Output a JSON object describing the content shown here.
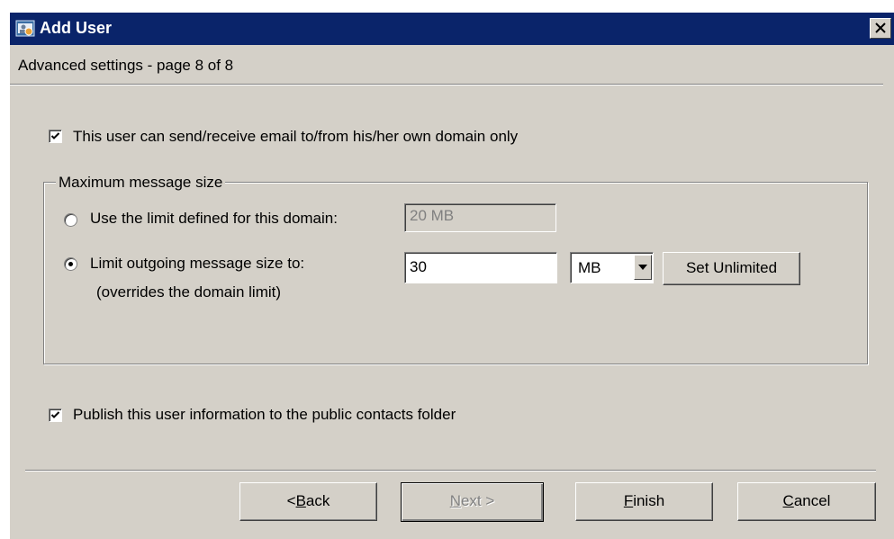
{
  "window": {
    "title": "Add User",
    "page_label": "Advanced settings - page 8 of 8"
  },
  "options": {
    "own_domain_only": {
      "label": "This user can send/receive email to/from his/her own domain only",
      "checked": true
    },
    "publish_contacts": {
      "label": "Publish this user information to the public contacts folder",
      "checked": true
    }
  },
  "size_group": {
    "legend": "Maximum message size",
    "use_domain_limit": {
      "label": "Use the limit defined for this domain:",
      "value": "20 MB",
      "selected": false
    },
    "limit_outgoing": {
      "label": "Limit outgoing message size to:",
      "note": "(overrides the domain limit)",
      "value": "30",
      "unit": "MB",
      "selected": true
    },
    "set_unlimited_label": "Set Unlimited"
  },
  "buttons": {
    "back": {
      "prefix": "< ",
      "accel": "B",
      "rest": "ack"
    },
    "next": {
      "accel": "N",
      "rest": "ext >"
    },
    "finish": {
      "accel": "F",
      "rest": "inish"
    },
    "cancel": {
      "accel": "C",
      "rest": "ancel"
    }
  },
  "icons": {
    "app": "user-window-icon",
    "close": "close-icon",
    "dropdown": "chevron-down-icon",
    "check": "checkmark-icon"
  },
  "colors": {
    "titlebar": "#0a246a",
    "face": "#d4d0c8"
  }
}
